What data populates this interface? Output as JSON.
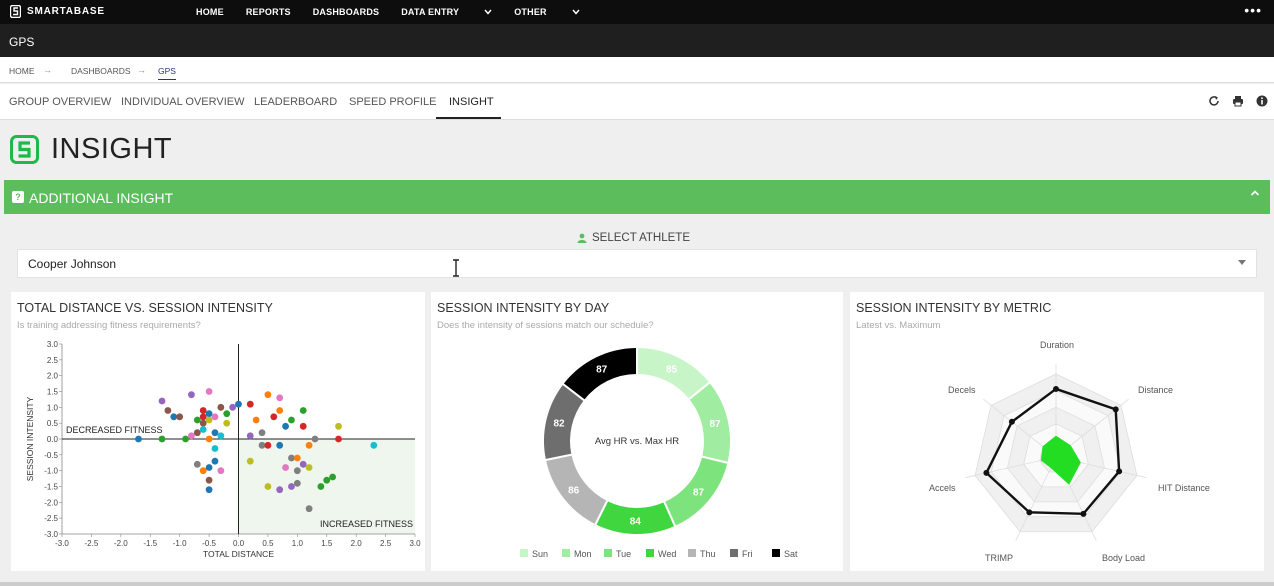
{
  "topnav": {
    "brand": "SMARTABASE",
    "items": [
      "HOME",
      "REPORTS",
      "DASHBOARDS",
      "DATA ENTRY",
      "OTHER"
    ],
    "more": "•••"
  },
  "page": {
    "section_title": "GPS"
  },
  "breadcrumb": {
    "items": [
      "HOME",
      "DASHBOARDS",
      "GPS"
    ]
  },
  "tabs": [
    "GROUP OVERVIEW",
    "INDIVIDUAL OVERVIEW",
    "LEADERBOARD",
    "SPEED PROFILE",
    "INSIGHT"
  ],
  "active_tab": "INSIGHT",
  "toolbar_icons": [
    "refresh-icon",
    "print-icon",
    "info-icon"
  ],
  "heading": "INSIGHT",
  "accordion": {
    "title": "ADDITIONAL INSIGHT",
    "icon": "help-icon",
    "state": "expanded"
  },
  "athlete_select": {
    "label": "SELECT ATHLETE",
    "value": "Cooper Johnson"
  },
  "colors": {
    "brand_green": "#5cbd5c",
    "logo_green": "#1fb84a",
    "dark": "#0d0d0d"
  },
  "chart_data": [
    {
      "type": "scatter",
      "title": "TOTAL DISTANCE VS. SESSION INTENSITY",
      "subtitle": "Is training addressing fitness requirements?",
      "xlabel": "TOTAL DISTANCE",
      "ylabel": "SESSION INTENSITY",
      "xlim": [
        -3.0,
        3.0
      ],
      "ylim": [
        -3.0,
        3.0
      ],
      "xticks": [
        "-3.0",
        "-2.5",
        "-2.0",
        "-1.5",
        "-1.0",
        "-0.5",
        "0.0",
        "0.5",
        "1.0",
        "1.5",
        "2.0",
        "2.5",
        "3.0"
      ],
      "yticks": [
        "3.0",
        "2.5",
        "2.0",
        "1.5",
        "1.0",
        "0.5",
        "0.0",
        "-0.5",
        "-1.0",
        "-1.5",
        "-2.0",
        "-2.5",
        "-3.0"
      ],
      "annotations": [
        "DECREASED FITNESS",
        "INCREASED FITNESS"
      ],
      "points": [
        [
          -1.7,
          0.0,
          "#1f77b4"
        ],
        [
          -1.3,
          0.0,
          "#2ca02c"
        ],
        [
          -1.3,
          1.2,
          "#9467bd"
        ],
        [
          -1.2,
          0.9,
          "#8c564b"
        ],
        [
          -1.1,
          0.7,
          "#1f77b4"
        ],
        [
          -1.0,
          0.7,
          "#8c564b"
        ],
        [
          -0.9,
          0.0,
          "#2ca02c"
        ],
        [
          -0.8,
          1.4,
          "#9467bd"
        ],
        [
          -0.8,
          0.1,
          "#e377c2"
        ],
        [
          -0.7,
          0.2,
          "#8c564b"
        ],
        [
          -0.7,
          0.6,
          "#2ca02c"
        ],
        [
          -0.6,
          0.9,
          "#d62728"
        ],
        [
          -0.6,
          0.7,
          "#d62728"
        ],
        [
          -0.6,
          0.5,
          "#8c564b"
        ],
        [
          -0.6,
          0.3,
          "#17becf"
        ],
        [
          -0.5,
          1.5,
          "#e377c2"
        ],
        [
          -0.5,
          0.8,
          "#1f77b4"
        ],
        [
          -0.5,
          0.6,
          "#bcbd22"
        ],
        [
          -0.5,
          0.0,
          "#ff7f0e"
        ],
        [
          -0.4,
          0.7,
          "#e377c2"
        ],
        [
          -0.4,
          0.2,
          "#1f77b4"
        ],
        [
          -0.3,
          1.0,
          "#8c564b"
        ],
        [
          -0.3,
          0.1,
          "#17becf"
        ],
        [
          -0.2,
          0.8,
          "#2ca02c"
        ],
        [
          -0.2,
          0.5,
          "#bcbd22"
        ],
        [
          -0.1,
          1.0,
          "#9467bd"
        ],
        [
          0.0,
          1.1,
          "#1f77b4"
        ],
        [
          -0.7,
          -0.8,
          "#7f7f7f"
        ],
        [
          -0.6,
          -1.0,
          "#ff7f0e"
        ],
        [
          -0.5,
          -0.9,
          "#1f77b4"
        ],
        [
          -0.4,
          -0.7,
          "#1f77b4"
        ],
        [
          -0.5,
          -1.3,
          "#8c564b"
        ],
        [
          -0.5,
          -1.6,
          "#1f77b4"
        ],
        [
          -0.4,
          -0.3,
          "#17becf"
        ],
        [
          -0.3,
          -1.0,
          "#e377c2"
        ],
        [
          0.2,
          1.1,
          "#d62728"
        ],
        [
          0.3,
          0.6,
          "#ff7f0e"
        ],
        [
          0.5,
          1.4,
          "#ff7f0e"
        ],
        [
          0.4,
          0.2,
          "#7f7f7f"
        ],
        [
          0.7,
          1.3,
          "#e377c2"
        ],
        [
          0.7,
          0.9,
          "#ff7f0e"
        ],
        [
          0.6,
          0.7,
          "#d62728"
        ],
        [
          0.8,
          0.4,
          "#1f77b4"
        ],
        [
          0.9,
          0.6,
          "#2ca02c"
        ],
        [
          1.1,
          0.9,
          "#2ca02c"
        ],
        [
          1.1,
          0.4,
          "#d62728"
        ],
        [
          0.2,
          0.1,
          "#9467bd"
        ],
        [
          0.4,
          -0.2,
          "#7f7f7f"
        ],
        [
          0.5,
          -0.2,
          "#d62728"
        ],
        [
          0.7,
          -0.2,
          "#1f77b4"
        ],
        [
          0.9,
          -0.6,
          "#7f7f7f"
        ],
        [
          0.8,
          -0.9,
          "#e377c2"
        ],
        [
          1.0,
          -0.6,
          "#ff7f0e"
        ],
        [
          1.0,
          -1.0,
          "#7f7f7f"
        ],
        [
          1.1,
          -0.8,
          "#9467bd"
        ],
        [
          1.2,
          -0.2,
          "#ff7f0e"
        ],
        [
          1.3,
          0.0,
          "#7f7f7f"
        ],
        [
          1.5,
          -1.3,
          "#2ca02c"
        ],
        [
          1.6,
          -1.2,
          "#2ca02c"
        ],
        [
          1.4,
          -1.5,
          "#2ca02c"
        ],
        [
          1.7,
          0.4,
          "#bcbd22"
        ],
        [
          1.7,
          0.0,
          "#d62728"
        ],
        [
          2.3,
          -0.2,
          "#17becf"
        ],
        [
          0.7,
          -1.6,
          "#9467bd"
        ],
        [
          0.5,
          -1.5,
          "#bcbd22"
        ],
        [
          1.2,
          -2.2,
          "#7f7f7f"
        ],
        [
          0.9,
          -1.5,
          "#9467bd"
        ],
        [
          1.0,
          -1.4,
          "#7f7f7f"
        ],
        [
          0.2,
          -0.7,
          "#bcbd22"
        ],
        [
          1.2,
          -0.9,
          "#bcbd22"
        ]
      ]
    },
    {
      "type": "pie",
      "title": "SESSION INTENSITY BY DAY",
      "subtitle": "Does the intensity of sessions match our schedule?",
      "center_label": "Avg HR vs. Max HR",
      "categories": [
        "Sun",
        "Mon",
        "Tue",
        "Wed",
        "Thu",
        "Fri",
        "Sat"
      ],
      "values": [
        85,
        87,
        87,
        84,
        86,
        82,
        87
      ],
      "colors": [
        "#c8f5c8",
        "#a0eca0",
        "#7de47d",
        "#3fd63f",
        "#b5b5b5",
        "#6e6e6e",
        "#000000"
      ],
      "legend": "bottom"
    },
    {
      "type": "radar",
      "title": "SESSION INTENSITY BY METRIC",
      "subtitle": "Latest vs. Maximum",
      "axes": [
        "Duration",
        "Distance",
        "HIT Distance",
        "Body Load",
        "TRIMP",
        "Accels",
        "Decels"
      ],
      "series": [
        {
          "values": [
            0.82,
            0.92,
            0.78,
            0.76,
            0.74,
            0.86,
            0.68
          ],
          "color": "#111111"
        },
        {
          "values": [
            0.25,
            0.22,
            0.3,
            0.36,
            0.14,
            0.18,
            0.2
          ],
          "color": "#22dd22"
        }
      ],
      "rings": 5
    }
  ]
}
